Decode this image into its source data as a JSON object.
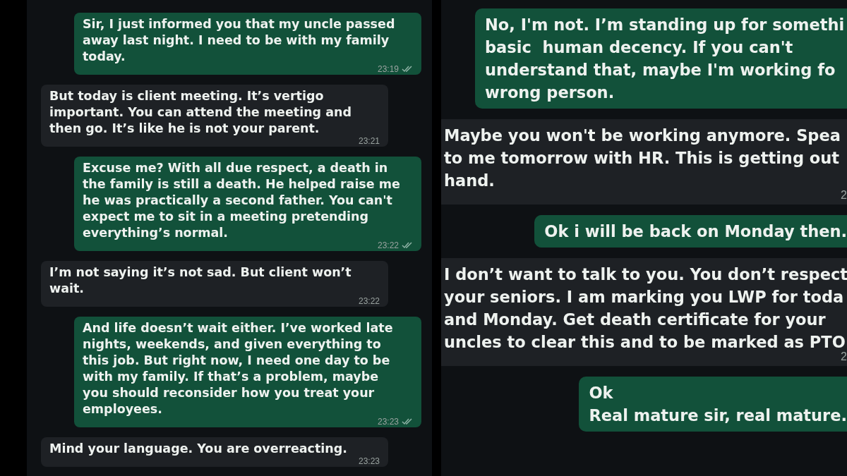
{
  "panels": [
    {
      "messages": [
        {
          "kind": "sent",
          "text": "Sir, I just informed you that my uncle passed\naway last night. I need to be with my family\ntoday.",
          "time": "23:19",
          "read": true
        },
        {
          "kind": "received",
          "text": "But today is client meeting. It’s vertigo\nimportant. You can attend the meeting and\nthen go. It’s like he is not your parent.",
          "time": "23:21"
        },
        {
          "kind": "sent",
          "text": "Excuse me? With all due respect, a death in\nthe family is still a death. He helped raise me\nhe was practically a second father. You can't\nexpect me to sit in a meeting pretending\neverything’s normal.",
          "time": "23:22",
          "read": true
        },
        {
          "kind": "received",
          "text": "I’m not saying it’s not sad. But client won’t\nwait.",
          "time": "23:22"
        },
        {
          "kind": "sent",
          "text": "And life doesn’t wait either. I’ve worked late\nnights, weekends, and given everything to\nthis job. But right now, I need one day to be\nwith my family. If that’s a problem, maybe\nyou should reconsider how you treat your\nemployees.",
          "time": "23:23",
          "read": true
        },
        {
          "kind": "received",
          "text": "Mind your language. You are overreacting.",
          "time": "23:23"
        }
      ]
    },
    {
      "messages": [
        {
          "kind": "sent",
          "text": "No, I'm not. I’m standing up for somethi\nbasic  human decency. If you can't\nunderstand that, maybe I'm working fo\nwrong person."
        },
        {
          "kind": "received",
          "text": "Maybe you won't be working anymore. Spea\nto me tomorrow with HR. This is getting out\nhand.",
          "time": "2"
        },
        {
          "kind": "sent",
          "text": "Ok i will be back on Monday then."
        },
        {
          "kind": "received",
          "text": "I don’t want to talk to you. You don’t respect\nyour seniors. I am marking you LWP for toda\nand Monday. Get death certificate for your\nuncles to clear this and to be marked as PTO",
          "time": "2"
        },
        {
          "kind": "sent",
          "text": "Ok\nReal mature sir, real mature."
        }
      ]
    }
  ]
}
